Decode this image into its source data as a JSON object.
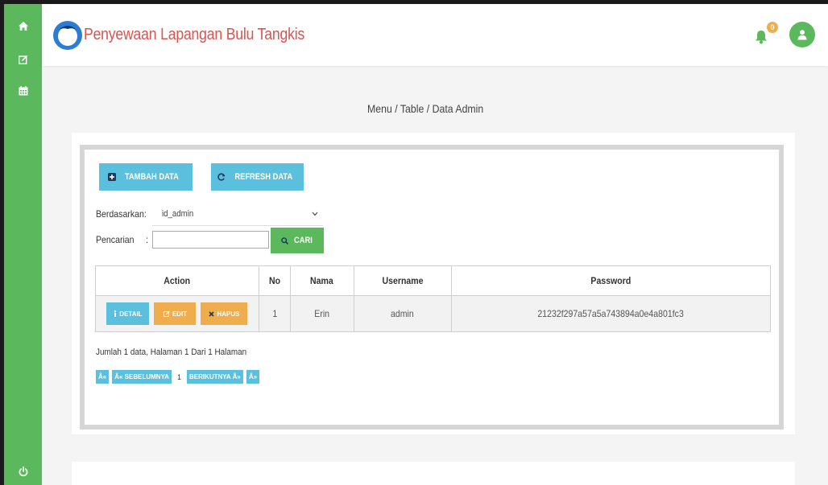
{
  "app": {
    "title": "Penyewaan Lapangan Bulu Tangkis",
    "notification_count": "0"
  },
  "sidebar": {
    "icons": [
      "home-icon",
      "edit-icon",
      "calendar-icon",
      "power-icon"
    ]
  },
  "breadcrumb": "Menu / Table / Data Admin",
  "toolbar": {
    "add_label": "TAMBAH DATA",
    "refresh_label": "REFRESH DATA"
  },
  "filter": {
    "by_label": "Berdasarkan:",
    "by_value": "id_admin",
    "search_label": "Pencarian",
    "search_value": "",
    "search_button": "CARI"
  },
  "table": {
    "headers": [
      "Action",
      "No",
      "Nama",
      "Username",
      "Password"
    ],
    "rows": [
      {
        "no": "1",
        "nama": "Erin",
        "username": "admin",
        "password": "21232f297a57a5a743894a0e4a801fc3"
      }
    ],
    "actions": {
      "detail": "DETAIL",
      "edit": "EDIT",
      "hapus": "HAPUS"
    }
  },
  "summary": "Jumlah 1 data, Halaman 1 Dari 1 Halaman",
  "pagination": {
    "first": "Â«",
    "prev": "Â« SEBELUMNYA",
    "current": "1",
    "next": "BERIKUTNYA Â»",
    "last": "Â»"
  },
  "colors": {
    "sidebar": "#5cb85c",
    "title": "#d9534f",
    "info_button": "#5bc0de",
    "warning_button": "#f0ad4e"
  }
}
